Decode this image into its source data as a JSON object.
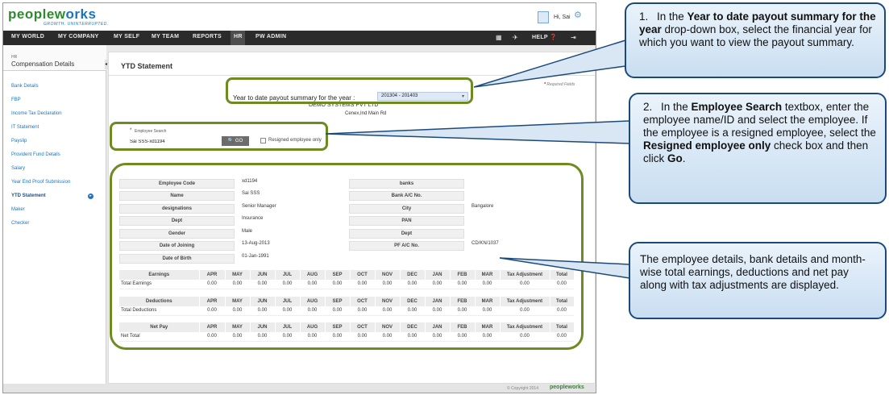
{
  "header": {
    "logo_main": "peoplew",
    "logo_accent": "orks",
    "tagline": "GROWTH. UNINTERRUPTED.",
    "greeting": "Hi, Sai"
  },
  "nav": {
    "items": [
      "MY WORLD",
      "MY COMPANY",
      "MY SELF",
      "MY TEAM",
      "REPORTS",
      "HR",
      "PW ADMIN"
    ],
    "help_label": "HELP"
  },
  "sidebar": {
    "sub": "HR",
    "title": "Compensation Details",
    "items": [
      "Bank Details",
      "FBP",
      "Income Tax Declaration",
      "IT Statement",
      "Payslip",
      "Provident Fund Details",
      "Salary",
      "Year End Proof Submission",
      "YTD Statement",
      "Maker",
      "Checker"
    ]
  },
  "main": {
    "title": "YTD Statement",
    "required_note": "Required Fields",
    "ytd_label": "Year to date payout summary for the year :",
    "ytd_value": "201304 - 201403",
    "company": "DEMO SYSTEMS PVT LTD",
    "address": "Cenex,Ind Main Rd",
    "emp_search_label": "Employee Search",
    "emp_search_value": "Sai SSS-xd1194",
    "go_label": "GO",
    "resigned_label": "Resigned employee only"
  },
  "details": {
    "left": [
      {
        "label": "Employee Code",
        "value": "xd1194"
      },
      {
        "label": "Name",
        "value": "Sai SSS"
      },
      {
        "label": "designations",
        "value": "Senior Manager"
      },
      {
        "label": "Dept",
        "value": "Insurance"
      },
      {
        "label": "Gender",
        "value": "Male"
      },
      {
        "label": "Date of Joining",
        "value": "13-Aug-2013"
      },
      {
        "label": "Date of Birth",
        "value": "01-Jan-1991"
      }
    ],
    "right": [
      {
        "label": "banks",
        "value": ""
      },
      {
        "label": "Bank A/C No.",
        "value": ""
      },
      {
        "label": "City",
        "value": "Bangalore"
      },
      {
        "label": "PAN",
        "value": ""
      },
      {
        "label": "Dept",
        "value": ""
      },
      {
        "label": "PF A/C No.",
        "value": "CD/KN/1037"
      }
    ]
  },
  "tables": {
    "months": [
      "APR",
      "MAY",
      "JUN",
      "JUL",
      "AUG",
      "SEP",
      "OCT",
      "NOV",
      "DEC",
      "JAN",
      "FEB",
      "MAR",
      "Tax Adjustment",
      "Total"
    ],
    "sections": [
      {
        "head": "Earnings",
        "row_label": "Total Earnings",
        "values": [
          "0.00",
          "0.00",
          "0.00",
          "0.00",
          "0.00",
          "0.00",
          "0.00",
          "0.00",
          "0.00",
          "0.00",
          "0.00",
          "0.00",
          "0.00",
          "0.00"
        ]
      },
      {
        "head": "Deductions",
        "row_label": "Total Deductions",
        "values": [
          "0.00",
          "0.00",
          "0.00",
          "0.00",
          "0.00",
          "0.00",
          "0.00",
          "0.00",
          "0.00",
          "0.00",
          "0.00",
          "0.00",
          "0.00",
          "0.00"
        ]
      },
      {
        "head": "Net Pay",
        "row_label": "Net Total",
        "values": [
          "0.00",
          "0.00",
          "0.00",
          "0.00",
          "0.00",
          "0.00",
          "0.00",
          "0.00",
          "0.00",
          "0.00",
          "0.00",
          "0.00",
          "0.00",
          "0.00"
        ]
      }
    ]
  },
  "footer": {
    "copyright": "© Copyright 2014",
    "logo": "peopleworks"
  },
  "callouts": {
    "c1": {
      "num": "1.",
      "pre": "In the ",
      "bold1": "Year to date payout summary for the year",
      "post": " drop-down box, select the financial year for which you want to view the payout summary."
    },
    "c2": {
      "num": "2.",
      "pre": "In the ",
      "bold1": "Employee Search",
      "mid": " textbox, enter the employee name/ID and select the employee. If the employee is a resigned employee, select the ",
      "bold2": "Resigned employee only",
      "mid2": " check box and then click ",
      "bold3": "Go",
      "post": "."
    },
    "c3": {
      "text": "The employee details, bank details and month-wise total earnings, deductions and net pay along with tax adjustments are displayed."
    }
  }
}
